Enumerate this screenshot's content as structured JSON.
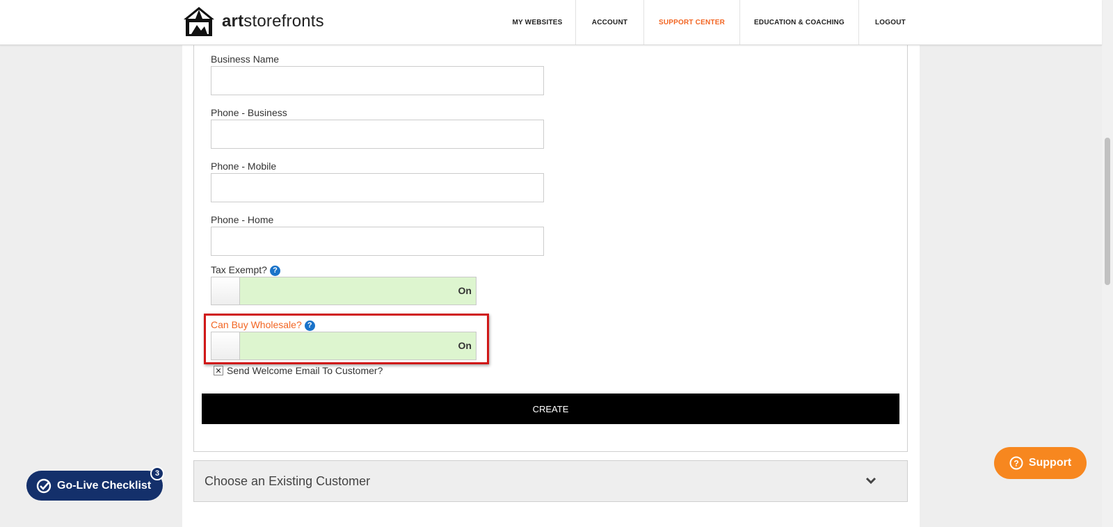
{
  "header": {
    "brand_bold": "art",
    "brand_light": "storefronts",
    "nav": [
      {
        "label": "MY WEBSITES"
      },
      {
        "label": "ACCOUNT"
      },
      {
        "label": "SUPPORT CENTER"
      },
      {
        "label": "EDUCATION & COACHING"
      },
      {
        "label": "LOGOUT"
      }
    ]
  },
  "form": {
    "business_name": {
      "label": "Business Name",
      "value": ""
    },
    "phone_business": {
      "label": "Phone - Business",
      "value": ""
    },
    "phone_mobile": {
      "label": "Phone - Mobile",
      "value": ""
    },
    "phone_home": {
      "label": "Phone - Home",
      "value": ""
    },
    "tax_exempt": {
      "label": "Tax Exempt?",
      "state": "On"
    },
    "can_buy_wholesale": {
      "label": "Can Buy Wholesale?",
      "state": "On"
    },
    "welcome_email": {
      "label": "Send Welcome Email To Customer?",
      "mark": "✕"
    },
    "create_label": "CREATE"
  },
  "existing_customer": {
    "title": "Choose an Existing Customer"
  },
  "widgets": {
    "golive_label": "Go-Live Checklist",
    "golive_count": "3",
    "support_label": "Support"
  },
  "colors": {
    "accent_orange": "#f26522",
    "support_orange": "#f7871f",
    "toggle_on_green": "#ddf5cf",
    "highlight_red": "#d01818",
    "golive_navy": "#14306b"
  }
}
